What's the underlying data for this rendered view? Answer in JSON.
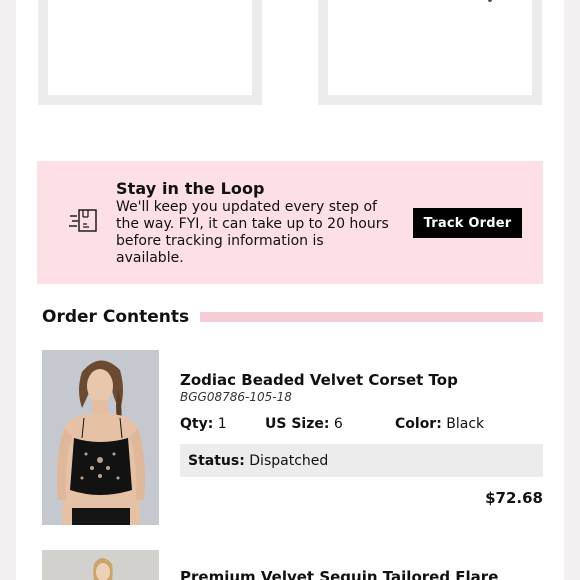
{
  "loop_banner": {
    "title": "Stay in the Loop",
    "text": "We'll keep you updated every step of the way. FYI, it can take up to 20 hours before tracking information is available.",
    "button_label": "Track Order",
    "icon": "delivery-truck-icon"
  },
  "order_contents": {
    "title": "Order Contents",
    "items": [
      {
        "name": "Zodiac Beaded Velvet Corset Top",
        "sku": "BGG08786-105-18",
        "qty_label": "Qty:",
        "qty": "1",
        "size_label": "US Size:",
        "size": "6",
        "color_label": "Color:",
        "color": "Black",
        "status_label": "Status:",
        "status": "Dispatched",
        "price": "$72.68"
      },
      {
        "name": "Premium Velvet Sequin Tailored Flare"
      }
    ]
  },
  "colors": {
    "banner_bg": "#fddfe6",
    "accent_line": "#f6ccd6",
    "button_bg": "#000000"
  }
}
